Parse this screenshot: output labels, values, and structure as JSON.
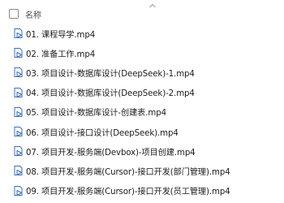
{
  "header": {
    "column_name": "名称",
    "sort_icon": "chevron-up-icon",
    "checkbox_checked": false
  },
  "files": [
    {
      "name": "01. 课程导学.mp4",
      "icon": "video-file-icon"
    },
    {
      "name": "02. 准备工作.mp4",
      "icon": "video-file-icon"
    },
    {
      "name": "03. 项目设计-数据库设计(DeepSeek)-1.mp4",
      "icon": "video-file-icon"
    },
    {
      "name": "04. 项目设计-数据库设计(DeepSeek)-2.mp4",
      "icon": "video-file-icon"
    },
    {
      "name": "05. 项目设计-数据库设计-创建表.mp4",
      "icon": "video-file-icon"
    },
    {
      "name": "06. 项目设计-接口设计(DeepSeek).mp4",
      "icon": "video-file-icon"
    },
    {
      "name": "07. 项目开发-服务端(Devbox)-项目创建.mp4",
      "icon": "video-file-icon"
    },
    {
      "name": "08. 项目开发-服务端(Cursor)-接口开发(部门管理).mp4",
      "icon": "video-file-icon"
    },
    {
      "name": "09. 项目开发-服务端(Cursor)-接口开发(员工管理).mp4",
      "icon": "video-file-icon"
    }
  ],
  "colors": {
    "icon_stroke": "#3a6fb8",
    "text": "#1b1b1b",
    "header_text": "#4a4a4a"
  }
}
